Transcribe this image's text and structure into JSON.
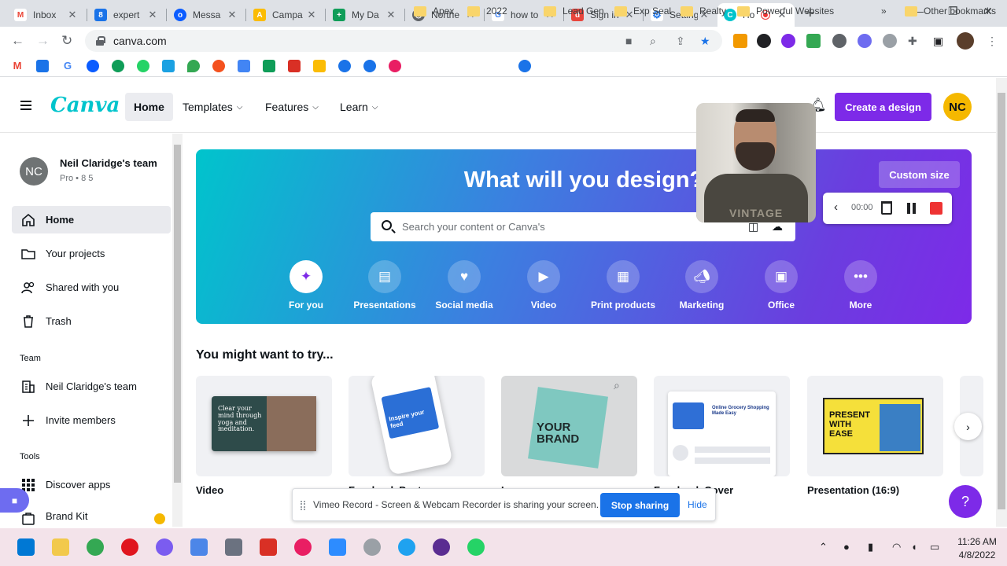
{
  "browser": {
    "tabs": [
      {
        "title": "Inbox",
        "favicon_color": "#ea4335",
        "favicon": "M"
      },
      {
        "title": "expert",
        "favicon_color": "#1a73e8",
        "favicon": "8"
      },
      {
        "title": "Messa",
        "favicon_color": "#0b5cff",
        "favicon": "o"
      },
      {
        "title": "Campa",
        "favicon_color": "#fbbc04",
        "favicon": "A"
      },
      {
        "title": "My Da",
        "favicon_color": "#0f9d58",
        "favicon": "+"
      },
      {
        "title": "Northe",
        "favicon_color": "#5f6368",
        "favicon": "◎"
      },
      {
        "title": "how to",
        "favicon_color": "#4285f4",
        "favicon": "G"
      },
      {
        "title": "Sign in",
        "favicon_color": "#e8453c",
        "favicon": "d"
      },
      {
        "title": "Setting",
        "favicon_color": "#1a73e8",
        "favicon": "⚙"
      },
      {
        "title": "Ho",
        "favicon_color": "#00c4cc",
        "favicon": "C",
        "active": true
      }
    ],
    "url": "canva.com",
    "bookmarks": [
      "Apex",
      "2022",
      "Lead Gen",
      "Exp Seal",
      "Realty",
      "Powerful Websites"
    ],
    "other_bookmarks": "Other bookmarks",
    "more_bookmarks": "»"
  },
  "canva_header": {
    "logo": "Canva",
    "nav": [
      {
        "label": "Home",
        "active": true
      },
      {
        "label": "Templates",
        "chevron": true
      },
      {
        "label": "Features",
        "chevron": true
      },
      {
        "label": "Learn",
        "chevron": true
      }
    ],
    "create_button": "Create a design",
    "avatar_initials": "NC"
  },
  "sidebar": {
    "team_avatar": "NC",
    "team_name": "Neil Claridge's team",
    "team_meta": "Pro • 8 5",
    "items": [
      {
        "label": "Home",
        "icon": "home-icon",
        "active": true
      },
      {
        "label": "Your projects",
        "icon": "folder-icon"
      },
      {
        "label": "Shared with you",
        "icon": "users-icon"
      },
      {
        "label": "Trash",
        "icon": "trash-icon"
      }
    ],
    "team_heading": "Team",
    "team_items": [
      {
        "label": "Neil Claridge's team",
        "icon": "building-icon"
      },
      {
        "label": "Invite members",
        "icon": "plus-icon"
      }
    ],
    "tools_heading": "Tools",
    "tool_items": [
      {
        "label": "Discover apps",
        "icon": "apps-grid-icon"
      },
      {
        "label": "Brand Kit",
        "icon": "brand-kit-icon"
      }
    ]
  },
  "hero": {
    "title": "What will you design?",
    "custom_size": "Custom size",
    "search_placeholder": "Search your content or Canva's",
    "categories": [
      {
        "label": "For you",
        "icon": "sparkle-icon",
        "selected": true
      },
      {
        "label": "Presentations",
        "icon": "presentation-icon"
      },
      {
        "label": "Social media",
        "icon": "heart-chat-icon"
      },
      {
        "label": "Video",
        "icon": "video-camera-icon"
      },
      {
        "label": "Print products",
        "icon": "printer-icon"
      },
      {
        "label": "Marketing",
        "icon": "megaphone-icon"
      },
      {
        "label": "Office",
        "icon": "briefcase-icon"
      },
      {
        "label": "More",
        "icon": "more-dots-icon"
      }
    ]
  },
  "recorder": {
    "timer": "00:00",
    "shirt_text": "VINTAGE"
  },
  "try_section": {
    "heading": "You might want to try...",
    "cards": [
      {
        "label": "Video",
        "thumb_text": "Clear your mind through yoga and meditation."
      },
      {
        "label": "Facebook Post",
        "thumb_text": "Inspire your feed"
      },
      {
        "label": "Logo",
        "thumb_text": "YOUR BRAND"
      },
      {
        "label": "Facebook Cover",
        "thumb_text": "Online Grocery Shopping Made Easy"
      },
      {
        "label": "Presentation (16:9)",
        "thumb_text": "PRESENT WITH EASE"
      }
    ]
  },
  "share_notice": {
    "text": "Vimeo Record - Screen & Webcam Recorder is sharing your screen.",
    "stop_button": "Stop sharing",
    "hide_link": "Hide"
  },
  "help_button": "?",
  "taskbar": {
    "time": "11:26 AM",
    "date": "4/8/2022"
  },
  "colors": {
    "canva_purple": "#7d2ae8",
    "canva_teal": "#00c4cc",
    "avatar_yellow": "#f5b800"
  }
}
